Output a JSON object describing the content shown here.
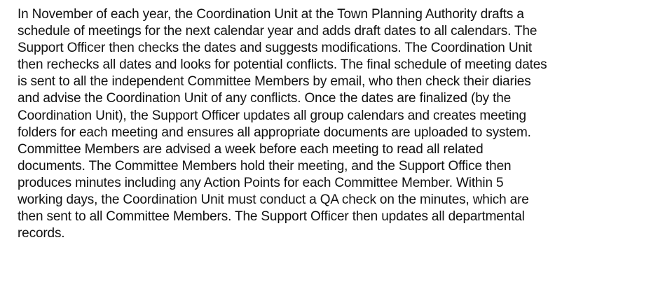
{
  "document": {
    "lines": [
      "In November of each year, the Coordination Unit at the Town Planning Authority drafts a",
      "schedule of meetings for the next calendar year and adds draft dates to all calendars. The",
      "Support Officer then checks the dates and suggests modifications. The Coordination Unit",
      "then rechecks all dates and looks for potential conflicts. The final schedule of meeting dates",
      "is sent to all the independent Committee Members by email, who then check their diaries",
      "and advise the Coordination Unit of any conflicts. Once the dates are finalized (by the",
      "Coordination Unit), the Support Officer updates all group calendars and creates meeting",
      "folders for each meeting and ensures all appropriate documents are uploaded to system.",
      "Committee Members are advised a week before each meeting to read all related",
      "documents. The Committee Members hold their meeting, and the Support Office then",
      "produces minutes including any Action Points for each Committee Member. Within 5",
      "working days, the Coordination Unit must conduct a QA check on the minutes, which are",
      "then sent to all Committee Members. The Support Officer then updates all departmental",
      "records."
    ]
  }
}
